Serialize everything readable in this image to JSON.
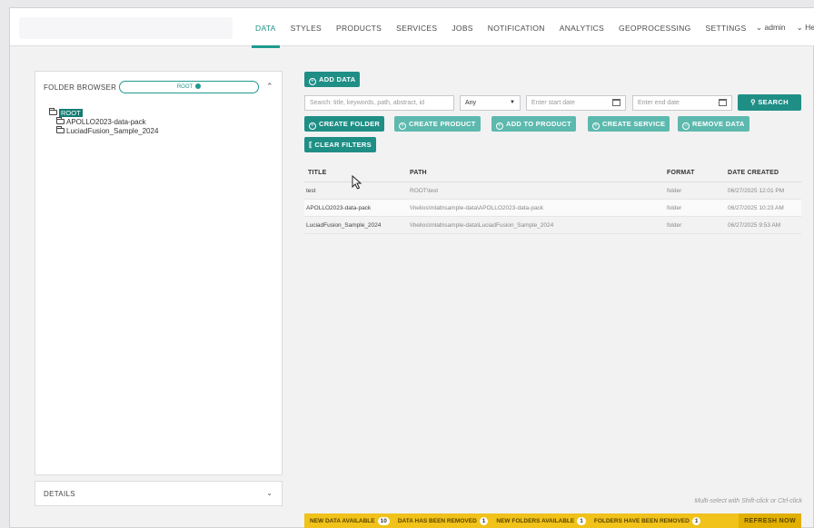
{
  "nav": {
    "items": [
      "DATA",
      "STYLES",
      "PRODUCTS",
      "SERVICES",
      "JOBS",
      "NOTIFICATION",
      "ANALYTICS",
      "GEOPROCESSING",
      "SETTINGS"
    ],
    "active": "DATA",
    "user": "admin",
    "help": "He"
  },
  "folder_browser": {
    "title": "FOLDER BROWSER",
    "root_pill": "ROOT",
    "tree": {
      "root": "ROOT",
      "children": [
        "APOLLO2023-data-pack",
        "LuciadFusion_Sample_2024"
      ]
    }
  },
  "details": {
    "title": "DETAILS"
  },
  "toolbar": {
    "add_data": "ADD DATA",
    "search_placeholder": "Search: title, keywords, path, abstract, id",
    "type_select": "Any",
    "start_date_placeholder": "Enter start date",
    "end_date_placeholder": "Enter end date",
    "search": "SEARCH",
    "create_folder": "CREATE FOLDER",
    "create_product": "CREATE PRODUCT",
    "add_to_product": "ADD TO PRODUCT",
    "create_service": "CREATE SERVICE",
    "remove_data": "REMOVE DATA",
    "clear_filters": "CLEAR FILTERS"
  },
  "table": {
    "columns": [
      "TITLE",
      "PATH",
      "FORMAT",
      "DATE CREATED"
    ],
    "rows": [
      {
        "title": "test",
        "path": "ROOT\\test",
        "format": "folder",
        "date": "06/27/2025 12:01 PM"
      },
      {
        "title": "APOLLO2023-data-pack",
        "path": "\\\\helios\\mlab\\sample-data\\APOLLO2023-data-pack",
        "format": "folder",
        "date": "06/27/2025 10:23 AM"
      },
      {
        "title": "LuciadFusion_Sample_2024",
        "path": "\\\\helios\\mlab\\sample-data\\LuciadFusion_Sample_2024",
        "format": "folder",
        "date": "06/27/2025 9:53 AM"
      }
    ]
  },
  "hint": "Multi-select with Shift-click or Ctrl-click",
  "status": {
    "new_data_label": "NEW DATA AVAILABLE",
    "new_data_count": "10",
    "data_removed_label": "DATA HAS BEEN REMOVED",
    "data_removed_count": "1",
    "new_folders_label": "NEW FOLDERS AVAILABLE",
    "new_folders_count": "1",
    "folders_removed_label": "FOLDERS HAVE BEEN REMOVED",
    "folders_removed_count": "1",
    "refresh": "REFRESH NOW"
  },
  "colors": {
    "accent": "#1f8f86",
    "accent_light": "#5db9ae",
    "status_bar": "#f0c21a"
  }
}
